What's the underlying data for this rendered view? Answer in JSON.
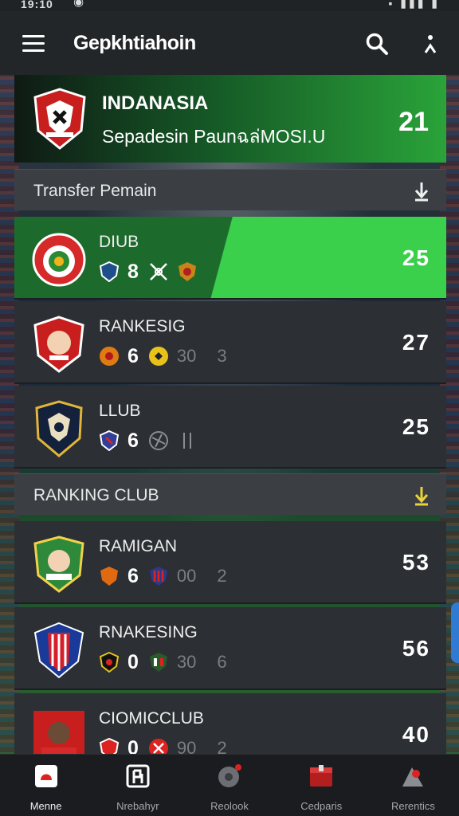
{
  "status": {
    "time": "19:10",
    "icons": "▪ ▮▮▮ ▮"
  },
  "app": {
    "title": "Gepkhtiahoin"
  },
  "featured": {
    "name": "INDANASIA",
    "subtitle": "Sepadesin Paunฉล่MOSI.U",
    "value": "21"
  },
  "sections": [
    {
      "label": "Transfer Pemain"
    },
    {
      "label": "RANKING CLUB"
    }
  ],
  "rows": [
    {
      "name": "DIUB",
      "stat1": "8",
      "stat2": "",
      "stat3": "",
      "value": "25",
      "highlight": true
    },
    {
      "name": "RANKESIG",
      "stat1": "6",
      "stat2": "30",
      "stat3": "3",
      "value": "27"
    },
    {
      "name": "LLUB",
      "stat1": "6",
      "stat2": "",
      "stat3": "",
      "value": "25"
    },
    {
      "name": "RAMIGAN",
      "stat1": "6",
      "stat2": "00",
      "stat3": "2",
      "value": "53"
    },
    {
      "name": "RNAKESING",
      "stat1": "0",
      "stat2": "30",
      "stat3": "6",
      "value": "56"
    },
    {
      "name": "CIOMICCLUB",
      "stat1": "0",
      "stat2": "90",
      "stat3": "2",
      "value": "40"
    }
  ],
  "nav": [
    {
      "label": "Menne",
      "icon": "home-icon"
    },
    {
      "label": "Nrebahyr",
      "icon": "team-icon"
    },
    {
      "label": "Reolook",
      "icon": "ball-icon"
    },
    {
      "label": "Cedparis",
      "icon": "calendar-icon"
    },
    {
      "label": "Rerentics",
      "icon": "stats-icon"
    }
  ],
  "colors": {
    "accent_green": "#3bd04c",
    "dark_green": "#1c6a2c",
    "card_bg": "#2c2f33",
    "section_bg": "#3b3f44",
    "sort_yellow": "#e8d23a"
  }
}
